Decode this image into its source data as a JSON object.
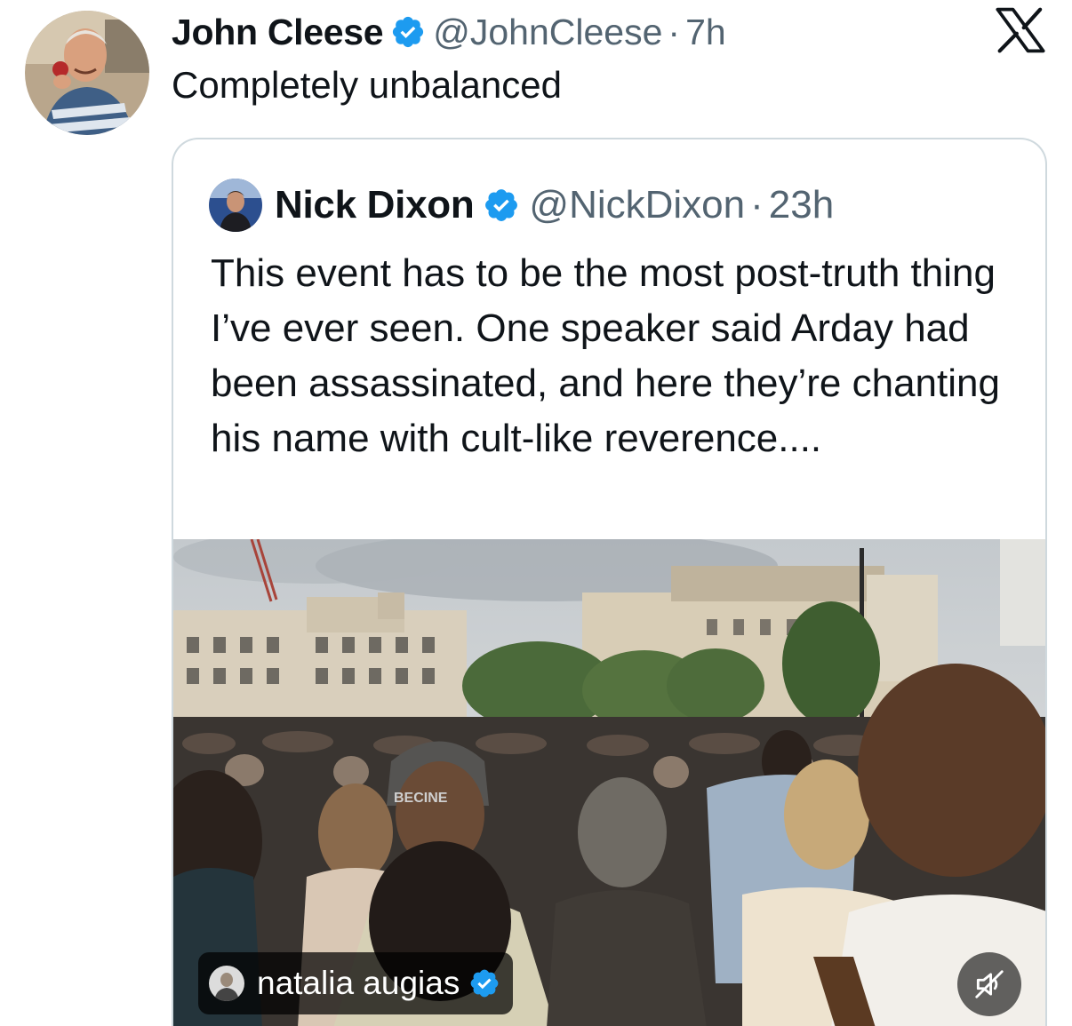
{
  "tweet": {
    "author_name": "John Cleese",
    "author_handle": "@JohnCleese",
    "separator": "·",
    "time": "7h",
    "text": "Completely unbalanced",
    "verified": true
  },
  "quoted_tweet": {
    "author_name": "Nick Dixon",
    "author_handle": "@NickDixon",
    "separator": "·",
    "time": "23h",
    "text": "This event has to be the most post-truth thing I’ve ever seen. One speaker said Arday had been assassinated, and here they’re chanting his name with cult-like reverence....",
    "verified": true,
    "media": {
      "type": "video",
      "credit_name": "natalia augias",
      "credit_verified": true,
      "muted": true,
      "cap_text": "BECINE"
    }
  },
  "icons": {
    "platform_logo": "x-logo-icon",
    "verified": "verified-badge-icon",
    "mute": "speaker-muted-icon"
  },
  "colors": {
    "verified_blue": "#1d9bf0",
    "text_primary": "#0f1419",
    "text_secondary": "#536471",
    "border": "#cfd9de"
  }
}
